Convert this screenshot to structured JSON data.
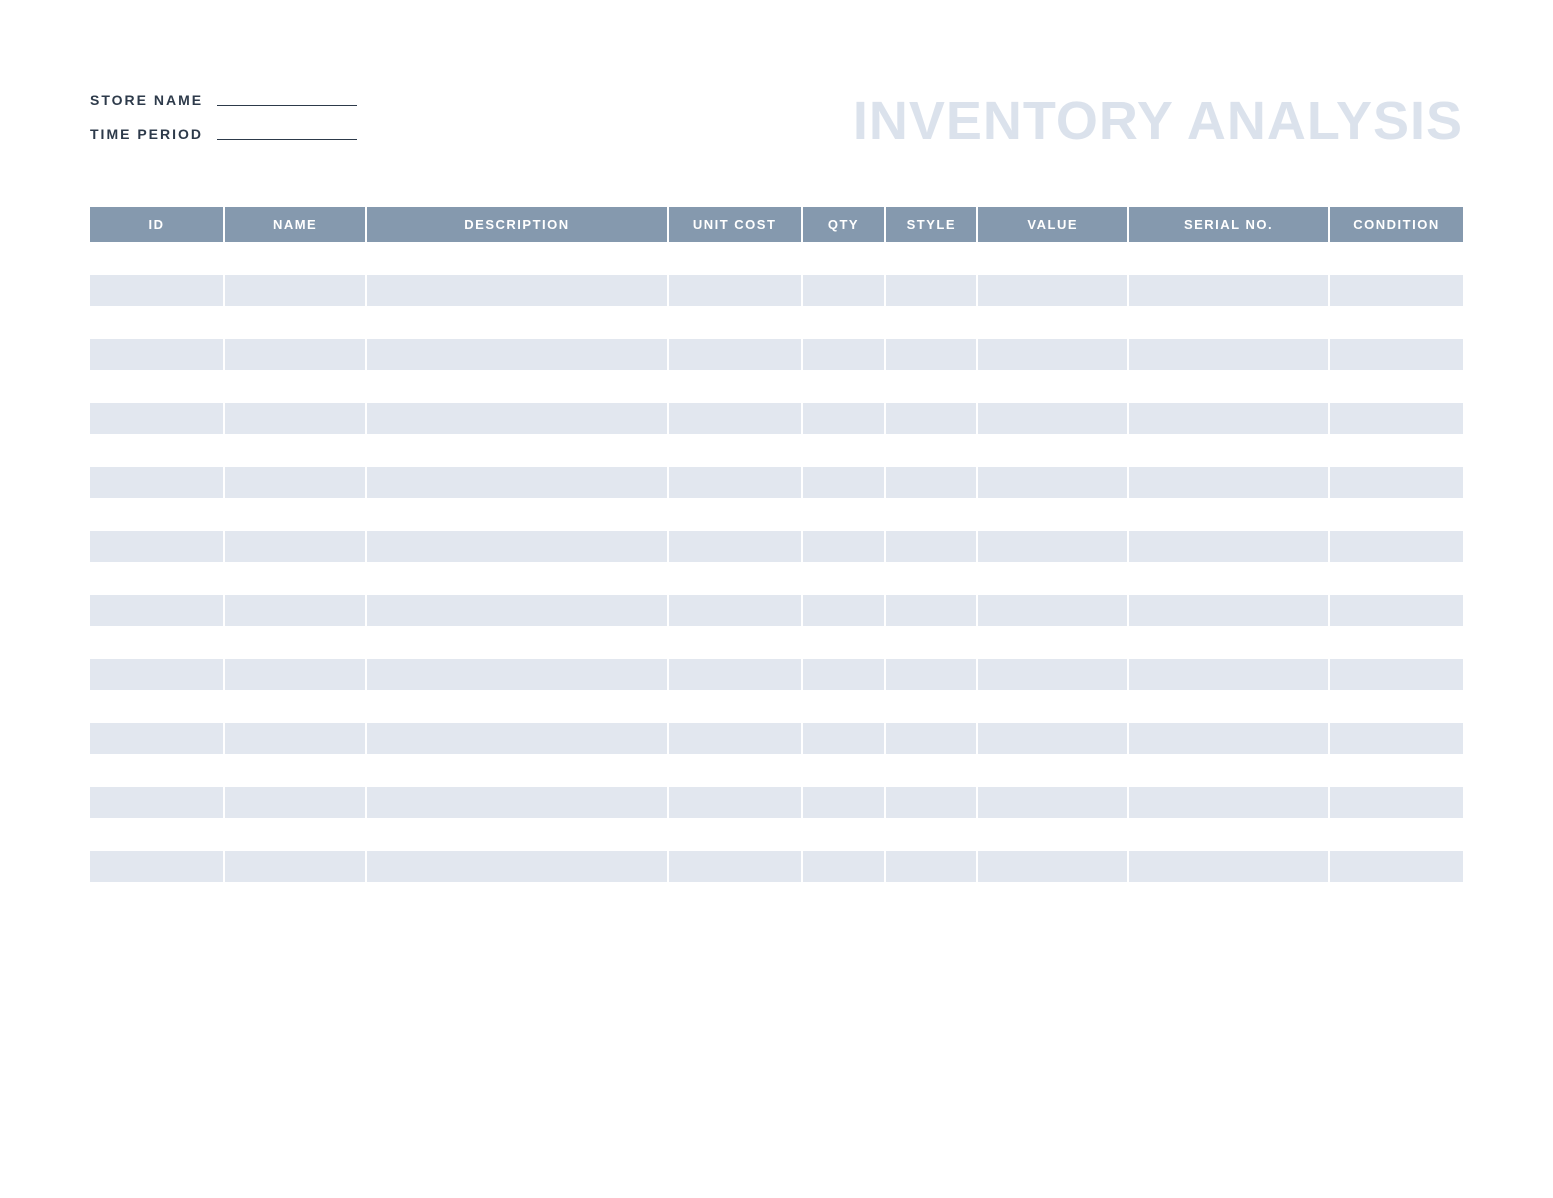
{
  "header": {
    "title": "INVENTORY ANALYSIS",
    "fields": {
      "store_name_label": "STORE NAME",
      "time_period_label": "TIME PERIOD"
    }
  },
  "table": {
    "columns": [
      {
        "label": "ID",
        "class": "col-id"
      },
      {
        "label": "NAME",
        "class": "col-name"
      },
      {
        "label": "DESCRIPTION",
        "class": "col-description"
      },
      {
        "label": "UNIT COST",
        "class": "col-unitcost"
      },
      {
        "label": "QTY",
        "class": "col-qty"
      },
      {
        "label": "STYLE",
        "class": "col-style"
      },
      {
        "label": "VALUE",
        "class": "col-value"
      },
      {
        "label": "SERIAL NO.",
        "class": "col-serial"
      },
      {
        "label": "CONDITION",
        "class": "col-condition"
      }
    ],
    "row_count": 20
  }
}
